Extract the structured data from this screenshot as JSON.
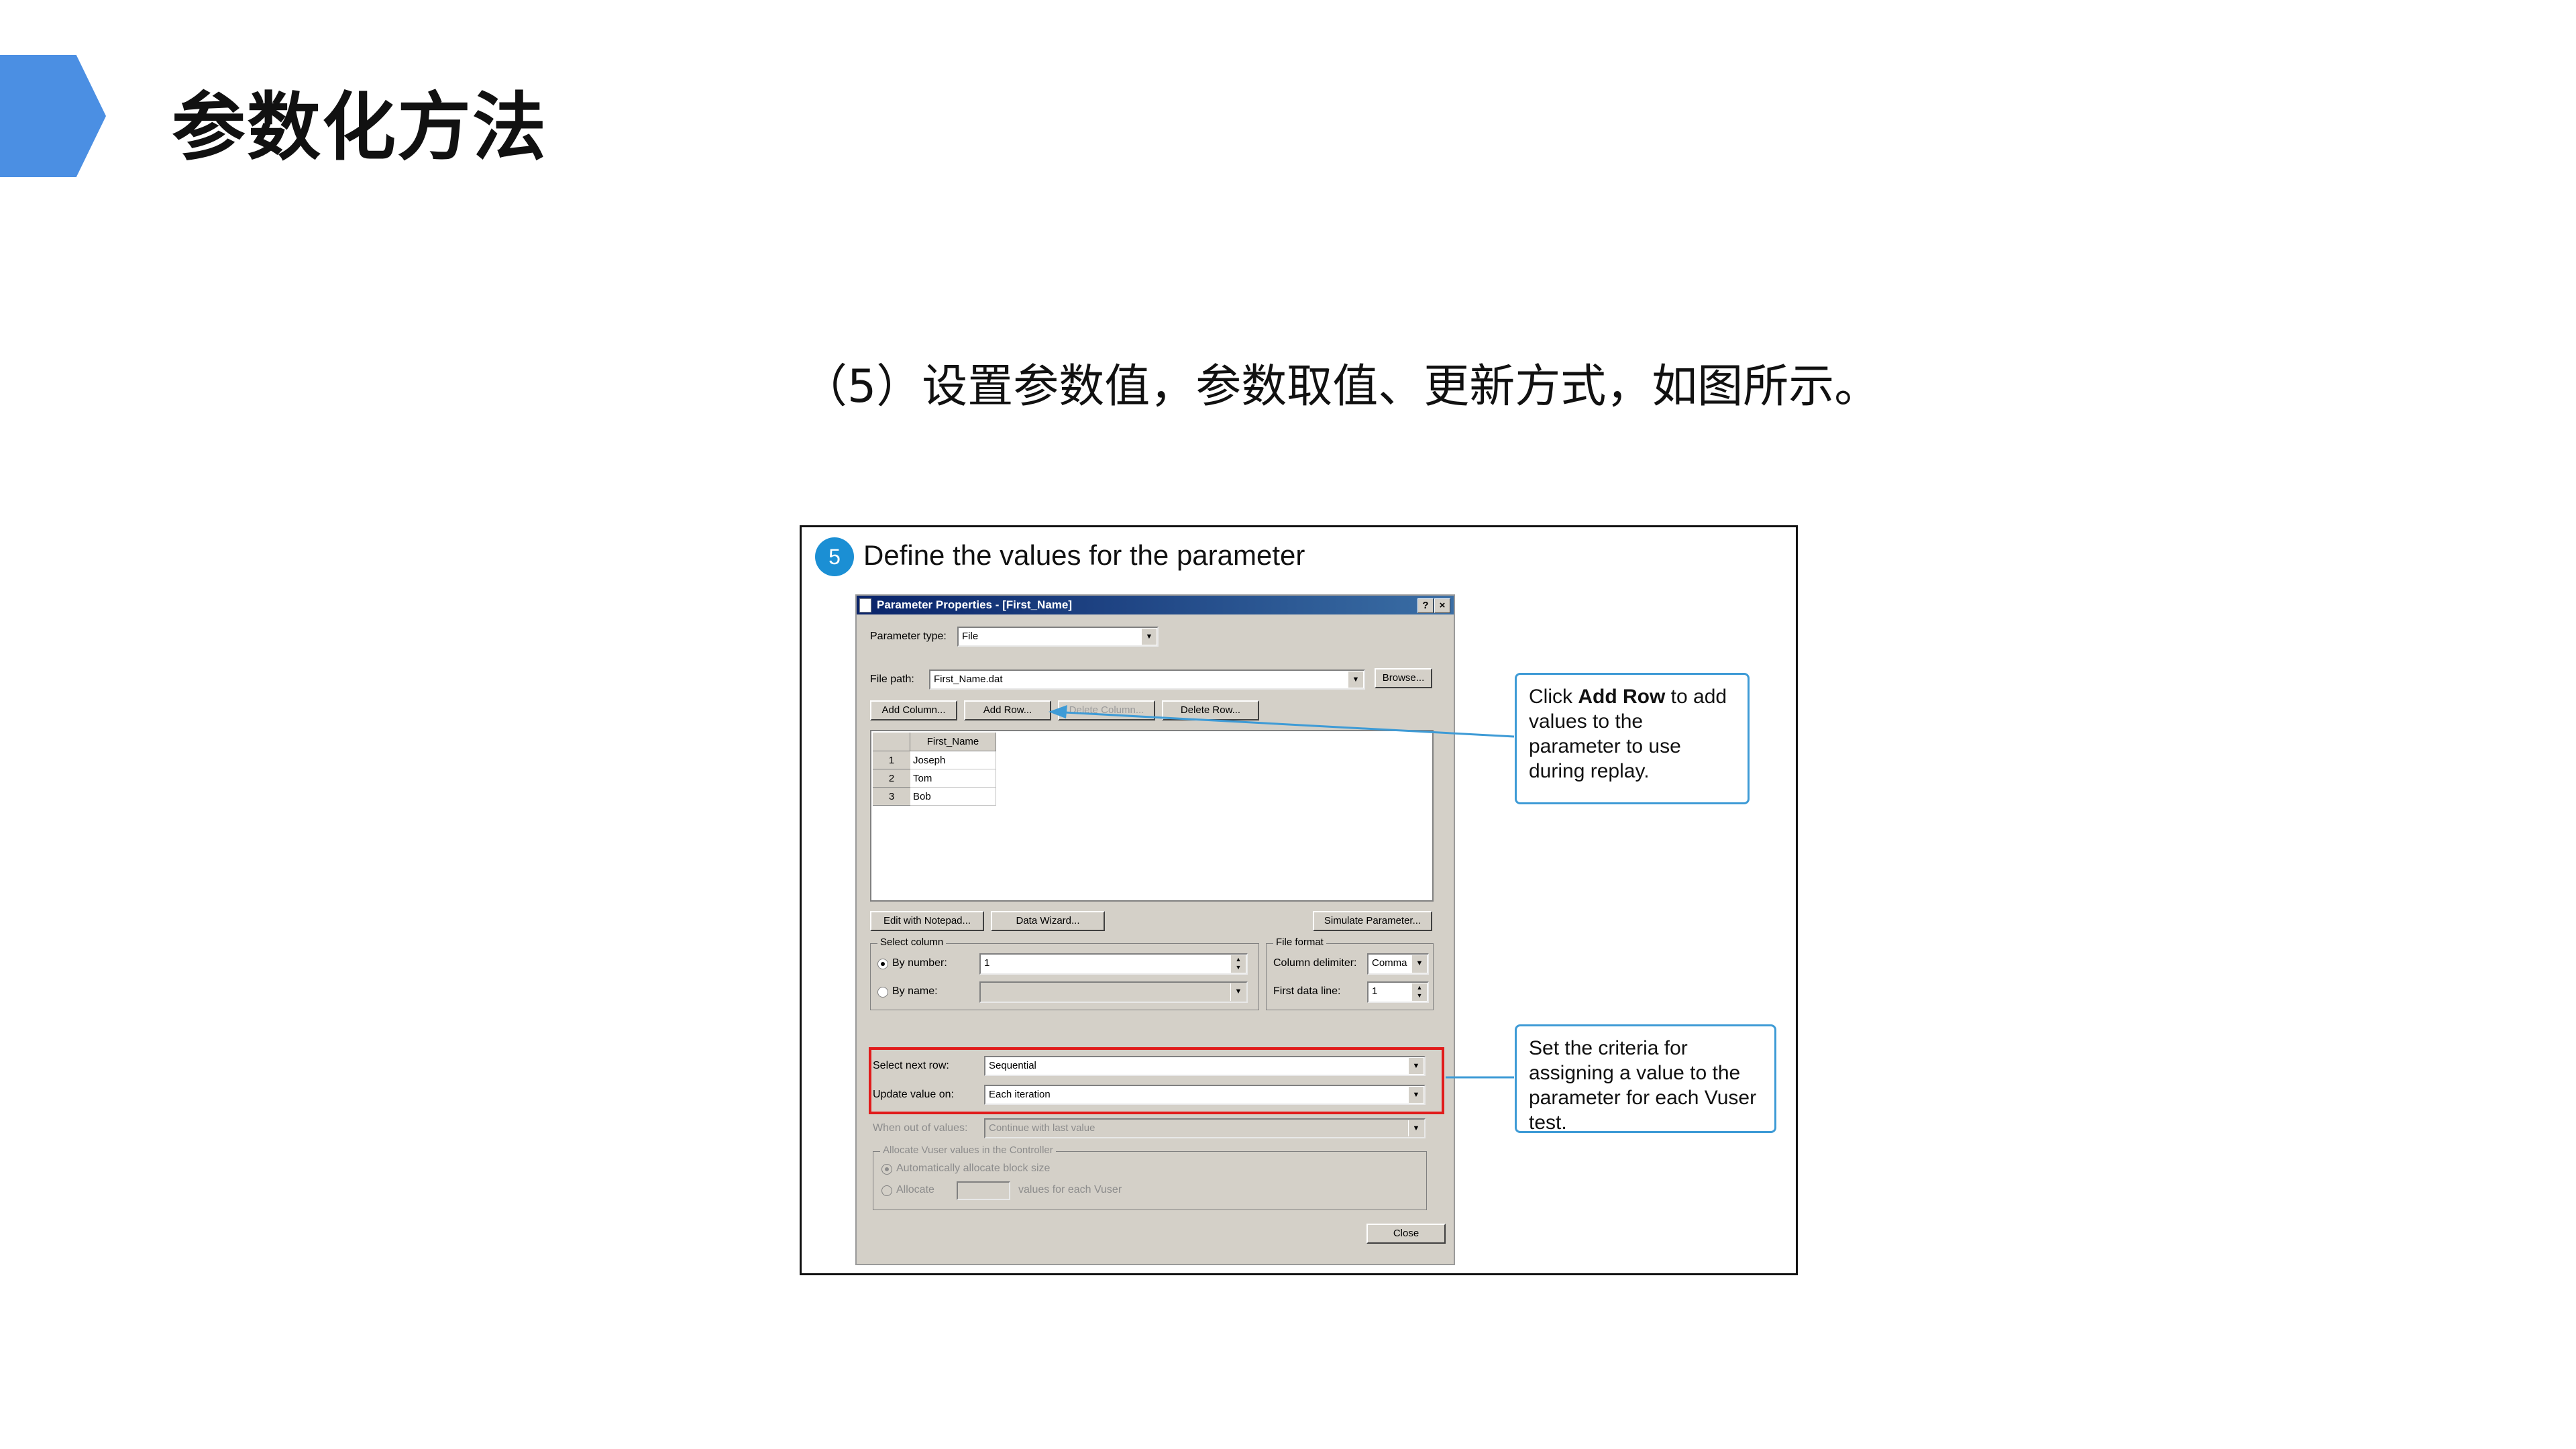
{
  "slide": {
    "title": "参数化方法",
    "subtitle": "（5）设置参数值，参数取值、更新方式，如图所示。"
  },
  "figure": {
    "step_number": "5",
    "step_title": "Define the values for the parameter"
  },
  "dialog": {
    "title": "Parameter Properties - [First_Name]",
    "help_button": "?",
    "close_x": "×",
    "parameter_type_label": "Parameter type:",
    "parameter_type_value": "File",
    "file_path_label": "File path:",
    "file_path_value": "First_Name.dat",
    "browse_button": "Browse...",
    "add_column_button": "Add Column...",
    "add_row_button": "Add Row...",
    "delete_column_button": "Delete Column...",
    "delete_row_button": "Delete Row...",
    "table": {
      "column_header": "First_Name",
      "rows": [
        {
          "num": "1",
          "value": "Joseph"
        },
        {
          "num": "2",
          "value": "Tom"
        },
        {
          "num": "3",
          "value": "Bob"
        }
      ]
    },
    "edit_notepad_button": "Edit with Notepad...",
    "data_wizard_button": "Data Wizard...",
    "simulate_button": "Simulate Parameter...",
    "select_column_group": "Select column",
    "by_number_label": "By number:",
    "by_number_value": "1",
    "by_name_label": "By name:",
    "file_format_group": "File format",
    "column_delimiter_label": "Column delimiter:",
    "column_delimiter_value": "Comma",
    "first_data_line_label": "First data line:",
    "first_data_line_value": "1",
    "select_next_row_label": "Select next row:",
    "select_next_row_value": "Sequential",
    "update_value_label": "Update value on:",
    "update_value_value": "Each iteration",
    "out_of_values_label": "When out of values:",
    "out_of_values_value": "Continue with last value",
    "allocate_group": "Allocate Vuser values in the Controller",
    "auto_allocate_label": "Automatically allocate block size",
    "allocate_label": "Allocate",
    "allocate_suffix": "values for each Vuser",
    "close_button": "Close"
  },
  "callouts": {
    "add_row_pre": "Click ",
    "add_row_bold": "Add Row",
    "add_row_post": " to add values to the parameter to use during replay.",
    "criteria": "Set the criteria for assigning a value to the parameter for each Vuser test."
  },
  "colors": {
    "accent_blue": "#4b8fe3",
    "step_badge": "#1b8fd4",
    "highlight_red": "#e11b1b",
    "callout_border": "#3e9bd6"
  }
}
